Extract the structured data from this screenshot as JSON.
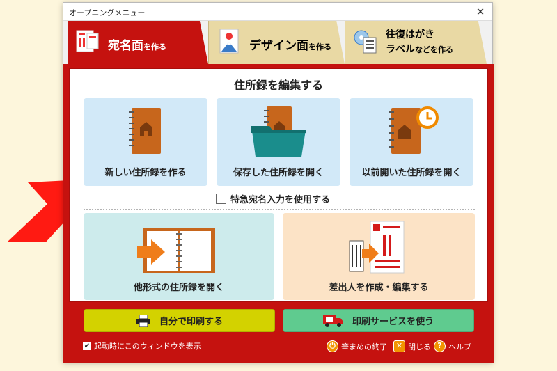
{
  "window": {
    "title": "オープニングメニュー",
    "close_glyph": "✕"
  },
  "tabs": [
    {
      "label_big": "宛名面",
      "label_small": "を作る"
    },
    {
      "label_big": "デザイン面",
      "label_small": "を作る"
    },
    {
      "label_line1": "往復はがき",
      "label_big": "ラベル",
      "label_small": "などを作る"
    }
  ],
  "section": {
    "title": "住所録を編集する"
  },
  "cards": {
    "new": "新しい住所録を作る",
    "open_saved": "保存した住所録を開く",
    "open_recent": "以前開いた住所録を開く",
    "other_format": "他形式の住所録を開く",
    "sender": "差出人を作成・編集する"
  },
  "express_checkbox": {
    "label": "特急宛名入力を使用する",
    "checked": false
  },
  "buttons": {
    "print_self": "自分で印刷する",
    "print_service": "印刷サービスを使う"
  },
  "footer": {
    "startup_label": "起動時にこのウィンドウを表示",
    "startup_checked": true,
    "exit": "筆まめの終了",
    "close": "閉じる",
    "help": "ヘルプ"
  },
  "colors": {
    "brand_red": "#c5120f",
    "tab_inactive": "#e9d9a4",
    "card_blue": "#d2e9f8",
    "card_teal": "#cdebec",
    "card_peach": "#fce3c6",
    "btn_yellow": "#d3d200",
    "btn_green": "#5fcb8f",
    "accent_orange": "#f29400",
    "arrow_red": "#ff1a12"
  }
}
